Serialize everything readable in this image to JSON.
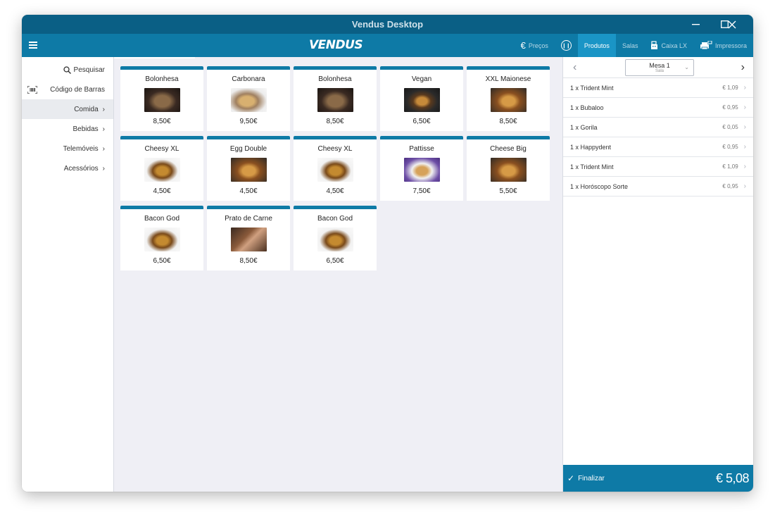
{
  "window": {
    "title": "Vendus Desktop"
  },
  "appbar": {
    "logo": "VENDUS",
    "nav": [
      {
        "icon": "euro-icon",
        "glyph": "€",
        "label": "Preços",
        "active": false
      },
      {
        "icon": "pause-icon",
        "glyph": "II",
        "label": "",
        "active": false
      },
      {
        "icon": "",
        "glyph": "",
        "label": "Produtos",
        "active": true
      },
      {
        "icon": "",
        "glyph": "",
        "label": "Salas",
        "active": false
      },
      {
        "icon": "cash-register-icon",
        "glyph": "🖩",
        "label": "Caixa LX",
        "active": false
      },
      {
        "icon": "printer-icon",
        "glyph": "🖶",
        "label": "Impressora",
        "active": false
      }
    ]
  },
  "sidebar": {
    "search_label": "Pesquisar",
    "barcode_label": "Código de Barras",
    "categories": [
      {
        "label": "Comida",
        "active": true
      },
      {
        "label": "Bebidas",
        "active": false
      },
      {
        "label": "Telemóveis",
        "active": false
      },
      {
        "label": "Acessórios",
        "active": false
      }
    ]
  },
  "products": [
    {
      "name": "Bolonhesa",
      "price": "8,50€",
      "img": "dark-pasta"
    },
    {
      "name": "Carbonara",
      "price": "9,50€",
      "img": "light-pasta"
    },
    {
      "name": "Bolonhesa",
      "price": "8,50€",
      "img": "dark-pasta"
    },
    {
      "name": "Vegan",
      "price": "6,50€",
      "img": "burger-dark"
    },
    {
      "name": "XXL Maionese",
      "price": "8,50€",
      "img": "burger-warm"
    },
    {
      "name": "Cheesy XL",
      "price": "4,50€",
      "img": "burger-light"
    },
    {
      "name": "Egg Double",
      "price": "4,50€",
      "img": "burger-warm"
    },
    {
      "name": "Cheesy XL",
      "price": "4,50€",
      "img": "burger-light"
    },
    {
      "name": "Pattisse",
      "price": "7,50€",
      "img": "burger-purple"
    },
    {
      "name": "Cheese Big",
      "price": "5,50€",
      "img": "burger-warm"
    },
    {
      "name": "Bacon God",
      "price": "6,50€",
      "img": "burger-light"
    },
    {
      "name": "Prato de Carne",
      "price": "8,50€",
      "img": "meat"
    },
    {
      "name": "Bacon God",
      "price": "6,50€",
      "img": "burger-light"
    }
  ],
  "order": {
    "table_name": "Mesa 1",
    "table_sub": "Sala",
    "items": [
      {
        "label": "1 x Trident Mint",
        "price": "€ 1,09"
      },
      {
        "label": "1 x Bubaloo",
        "price": "€ 0,95"
      },
      {
        "label": "1 x Gorila",
        "price": "€ 0,05"
      },
      {
        "label": "1 x Happydent",
        "price": "€ 0,95"
      },
      {
        "label": "1 x Trident Mint",
        "price": "€ 1,09"
      },
      {
        "label": "1 x Horóscopo Sorte",
        "price": "€ 0,95"
      }
    ],
    "finalize_label": "Finalizar",
    "total": "€ 5,08"
  },
  "colors": {
    "titlebar": "#0a5f85",
    "appbar": "#0e7aa6",
    "active_tab": "#1a95c6",
    "canvas": "#efeff5"
  }
}
